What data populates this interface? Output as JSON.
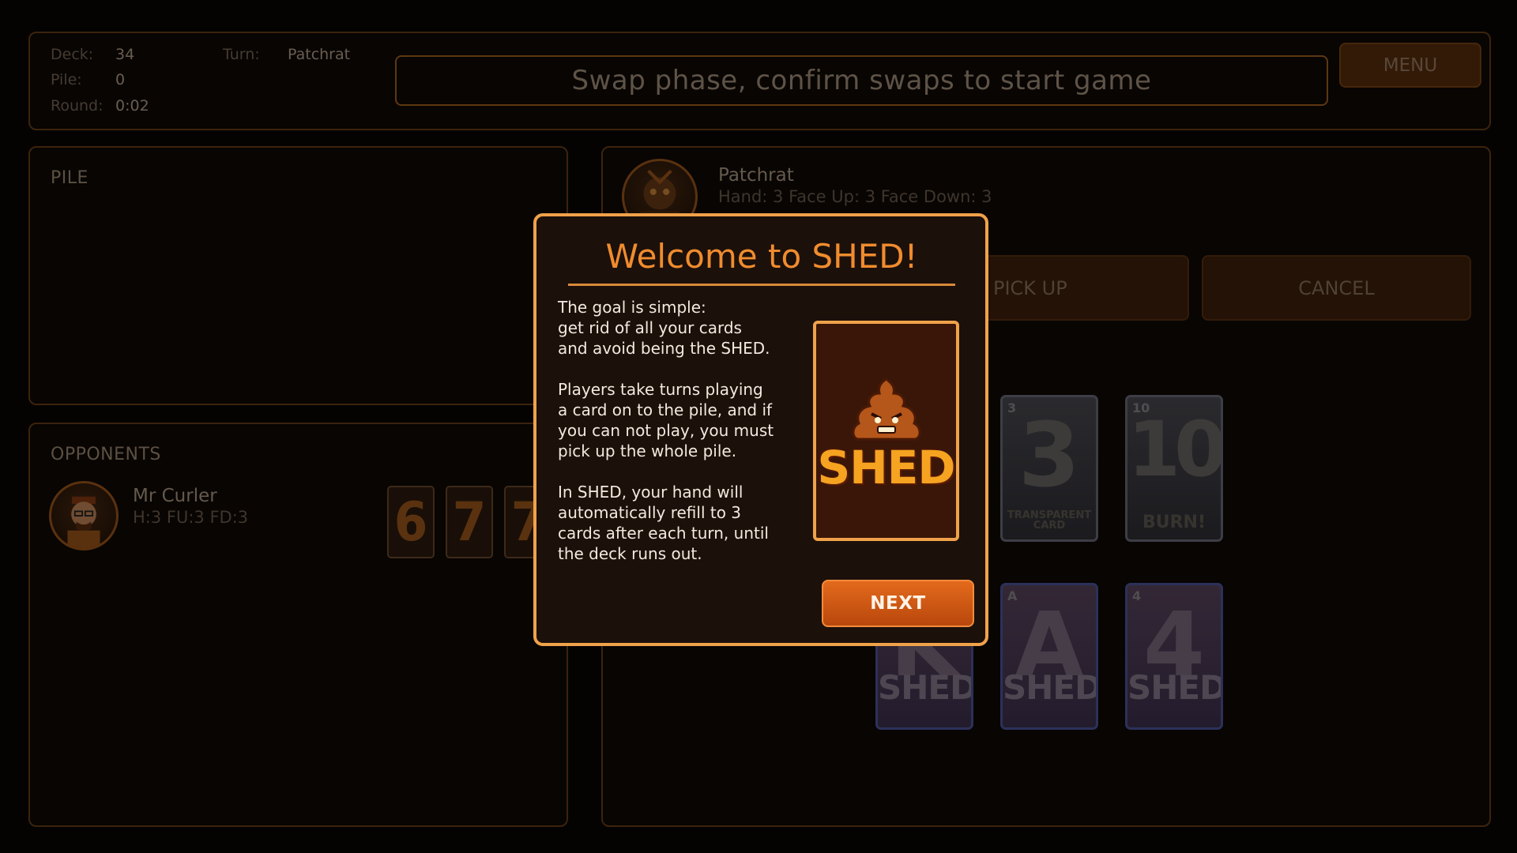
{
  "stats": {
    "deck_label": "Deck:",
    "deck_value": "34",
    "pile_label": "Pile:",
    "pile_value": "0",
    "round_label": "Round:",
    "round_value": "0:02",
    "turn_label": "Turn:",
    "turn_value": "Patchrat"
  },
  "status_message": "Swap phase, confirm swaps to start game",
  "menu_label": "MENU",
  "pile_panel": {
    "title": "PILE"
  },
  "opponents_panel": {
    "title": "OPPONENTS",
    "opponent": {
      "name": "Mr Curler",
      "info": "H:3  FU:3  FD:3",
      "cards": [
        "6",
        "7",
        "7"
      ]
    }
  },
  "player": {
    "name": "Patchrat",
    "info": "Hand: 3  Face Up: 3  Face Down: 3",
    "pickup_label": "PICK UP",
    "cancel_label": "CANCEL",
    "face_up_cards": [
      {
        "rank": "3",
        "subtitle": "TRANSPARENT CARD"
      },
      {
        "rank": "10",
        "subtitle": "BURN!"
      }
    ],
    "face_down_cards": [
      {
        "rank": "K",
        "logo": "SHED"
      },
      {
        "rank": "A",
        "logo": "SHED"
      },
      {
        "rank": "4",
        "logo": "SHED"
      }
    ]
  },
  "modal": {
    "title": "Welcome to SHED!",
    "paragraph1": "The goal is simple:\nget rid of all your cards\nand avoid being the SHED.",
    "paragraph2": "Players take turns playing\na card on to the pile, and if\nyou can not play, you must\npick up the whole pile.",
    "paragraph3": "In SHED, your hand will\nautomatically refill to 3\ncards after each turn, until\nthe deck runs out.",
    "logo_text": "SHED",
    "next_label": "NEXT"
  },
  "colors": {
    "accent": "#f0a24a",
    "button": "#d45a15",
    "background": "#050302"
  }
}
